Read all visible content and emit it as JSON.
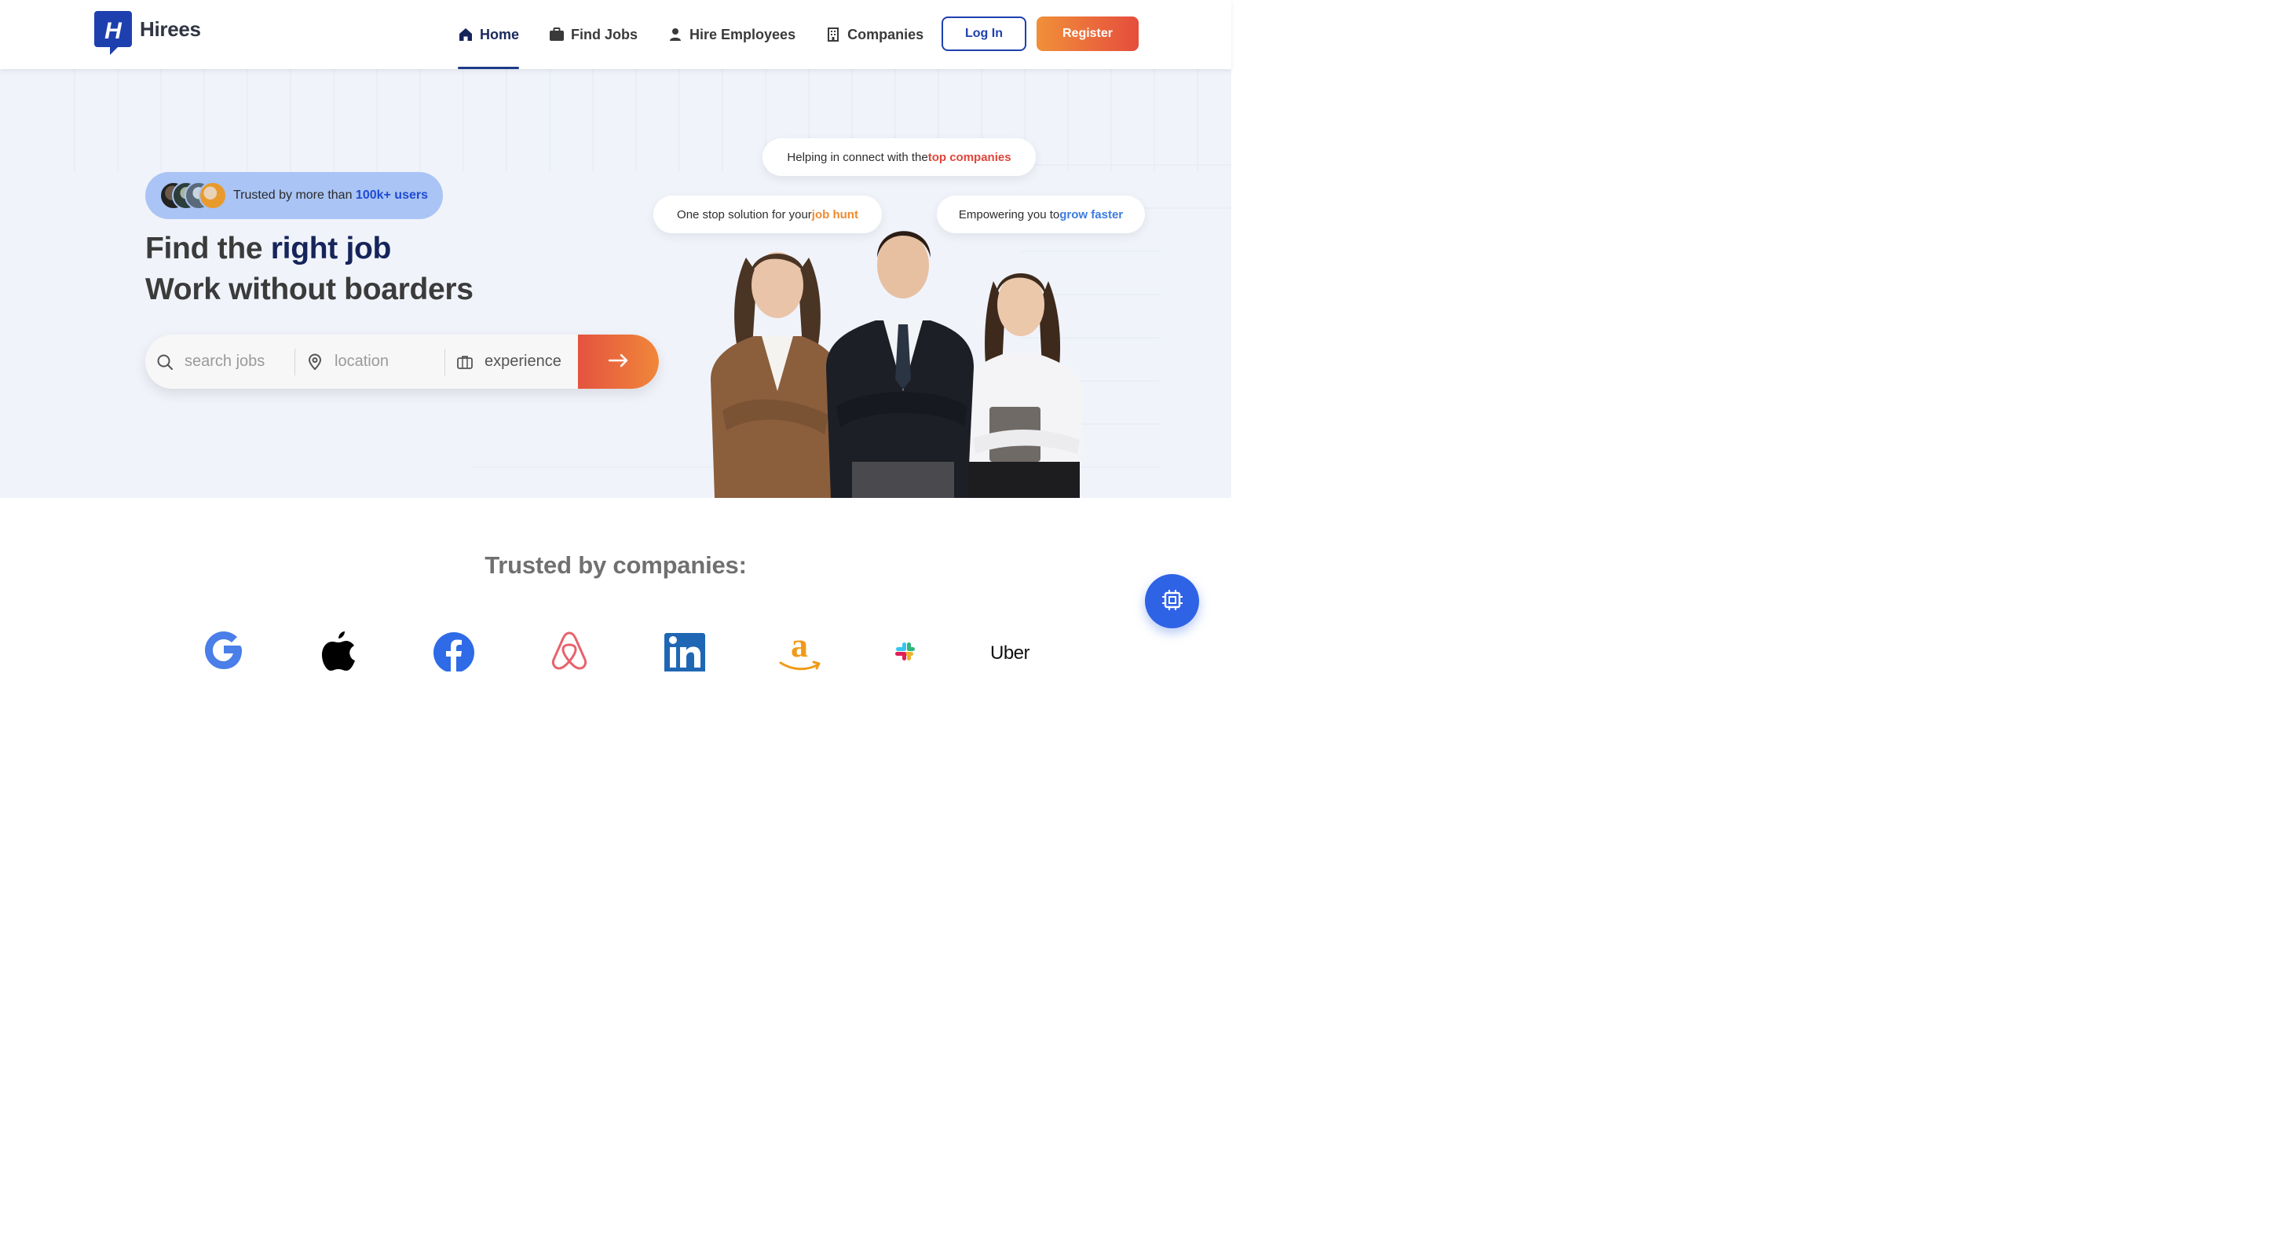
{
  "brand": {
    "name": "Hirees",
    "logo_letter": "H"
  },
  "nav": {
    "items": [
      {
        "label": "Home",
        "icon": "home-icon",
        "active": true
      },
      {
        "label": "Find Jobs",
        "icon": "briefcase-icon",
        "active": false
      },
      {
        "label": "Hire Employees",
        "icon": "user-icon",
        "active": false
      },
      {
        "label": "Companies",
        "icon": "building-icon",
        "active": false
      }
    ],
    "login_label": "Log In",
    "register_label": "Register"
  },
  "hero": {
    "trust": {
      "prefix": "Trusted by more than ",
      "highlight": "100k+ users"
    },
    "headline": {
      "line1_prefix": "Find the ",
      "line1_highlight": "right job",
      "line2": "Work without boarders"
    },
    "search": {
      "jobs_placeholder": "search jobs",
      "location_placeholder": "location",
      "experience_label": "experience"
    },
    "bubbles": [
      {
        "prefix": "Helping in connect with the ",
        "highlight": "top companies"
      },
      {
        "prefix": "One stop solution for your ",
        "highlight": "job hunt"
      },
      {
        "prefix": "Empowering you to ",
        "highlight": "grow faster"
      }
    ]
  },
  "trusted": {
    "title": "Trusted by companies:",
    "logos": [
      "google-logo",
      "apple-logo",
      "facebook-logo",
      "airbnb-logo",
      "linkedin-logo",
      "amazon-logo",
      "slack-logo",
      "uber-logo"
    ],
    "uber_text": "Uber"
  },
  "colors": {
    "primary": "#1e40af",
    "accent_orange": "#f0903a",
    "accent_red": "#e54d3c",
    "hero_bg": "#f0f3fa",
    "fab": "#2f63e6"
  }
}
